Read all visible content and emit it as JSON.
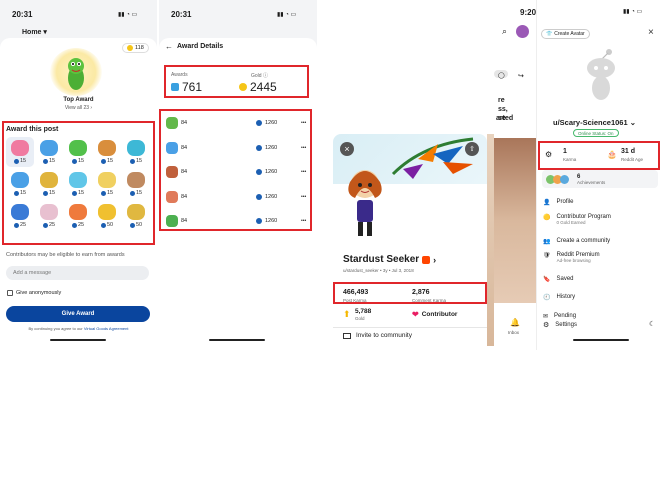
{
  "p1": {
    "time": "20:31",
    "home_label": "Home",
    "balance": "118",
    "top_award_title": "Top Award",
    "view_all": "View all 23",
    "section_title": "Award this post",
    "award_costs": [
      "15",
      "15",
      "15",
      "15",
      "15",
      "15",
      "15",
      "15",
      "15",
      "15",
      "25",
      "25",
      "25",
      "50",
      "50"
    ],
    "contributors_note": "Contributors may be eligible to earn from awards",
    "message_placeholder": "Add a message",
    "anonymous_label": "Give anonymously",
    "give_button": "Give Award",
    "agreement_prefix": "By continuing you agree to our",
    "agreement_link": "Virtual Goods Agreement"
  },
  "p2": {
    "time": "20:31",
    "title": "Award Details",
    "awards_label": "Awards",
    "awards_value": "761",
    "gold_label": "Gold",
    "gold_value": "2445",
    "rows": [
      {
        "count": "84",
        "gold": "1260"
      },
      {
        "count": "84",
        "gold": "1260"
      },
      {
        "count": "84",
        "gold": "1260"
      },
      {
        "count": "84",
        "gold": "1260"
      },
      {
        "count": "84",
        "gold": "1260"
      }
    ]
  },
  "p3": {
    "name": "Stardust Seeker",
    "meta": "u/stardust_seeker • 3y • Jul 3, 2018",
    "post_karma": "466,493",
    "post_karma_label": "Post Karma",
    "comment_karma": "2,876",
    "comment_karma_label": "Comment Karma",
    "gold": "5,788",
    "gold_label": "Gold",
    "contributor": "Contributor",
    "invite": "Invite to community"
  },
  "p4": {
    "time": "9:20",
    "create_avatar": "Create Avatar",
    "username": "u/Scary-Science1061",
    "online_status": "Online Status: On",
    "karma_value": "1",
    "karma_label": "Karma",
    "age_value": "31 d",
    "age_label": "Reddit Age",
    "achievements_count": "6",
    "achievements_label": "Achievements",
    "menu": [
      {
        "label": "Profile",
        "sub": ""
      },
      {
        "label": "Contributor Program",
        "sub": "0 Gold Earned"
      },
      {
        "label": "Create a community",
        "sub": ""
      },
      {
        "label": "Reddit Premium",
        "sub": "Ad-free browsing"
      },
      {
        "label": "Saved",
        "sub": ""
      },
      {
        "label": "History",
        "sub": ""
      },
      {
        "label": "Pending",
        "sub": ""
      }
    ],
    "settings": "Settings",
    "bg_text": [
      "re",
      "ss,",
      "se",
      "arted"
    ],
    "inbox": "Inbox"
  }
}
